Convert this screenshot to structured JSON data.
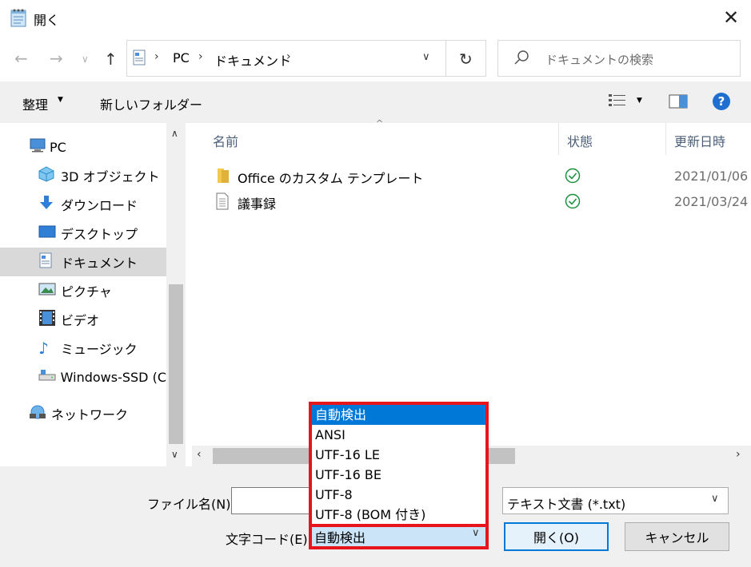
{
  "window": {
    "title": "開く"
  },
  "address": {
    "path": [
      "PC",
      "ドキュメント"
    ]
  },
  "search": {
    "placeholder": "ドキュメントの検索"
  },
  "toolbar": {
    "organize": "整理",
    "new_folder": "新しいフォルダー"
  },
  "sidebar": {
    "items": [
      {
        "label": "PC"
      },
      {
        "label": "3D オブジェクト"
      },
      {
        "label": "ダウンロード"
      },
      {
        "label": "デスクトップ"
      },
      {
        "label": "ドキュメント"
      },
      {
        "label": "ピクチャ"
      },
      {
        "label": "ビデオ"
      },
      {
        "label": "ミュージック"
      },
      {
        "label": "Windows-SSD (C"
      },
      {
        "label": "ネットワーク"
      }
    ]
  },
  "columns": {
    "name": "名前",
    "status": "状態",
    "modified": "更新日時"
  },
  "files": [
    {
      "name": "Office のカスタム テンプレート",
      "date": "2021/01/06"
    },
    {
      "name": "議事録",
      "date": "2021/03/24"
    }
  ],
  "form": {
    "filename_label": "ファイル名(N):",
    "filename_value": "",
    "filetype_value": "テキスト文書 (*.txt)",
    "encoding_label": "文字コード(E):",
    "encoding_value": "自動検出",
    "open_button": "開く(O)",
    "cancel_button": "キャンセル"
  },
  "encoding_options": [
    "自動検出",
    "ANSI",
    "UTF-16 LE",
    "UTF-16 BE",
    "UTF-8",
    "UTF-8 (BOM 付き)"
  ],
  "colors": {
    "accent": "#0078d7",
    "highlight_box": "#e8141b",
    "selected_nav": "#d9d9d9",
    "check_green": "#1e8f3e"
  }
}
